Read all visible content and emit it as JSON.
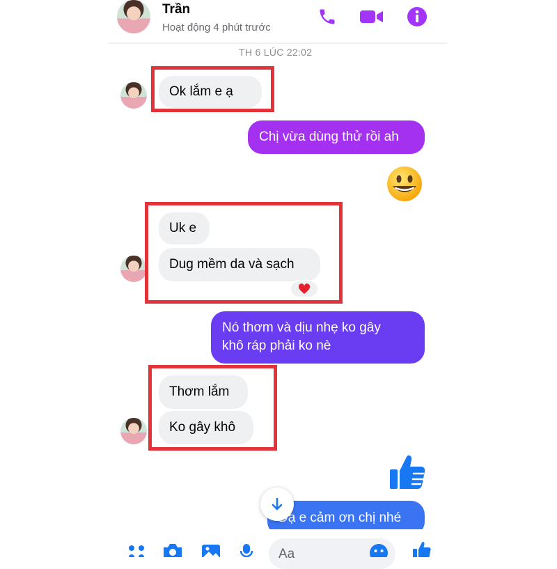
{
  "header": {
    "contact_name": "Trần",
    "status": "Hoạt động 4 phút trước",
    "actions": [
      "phone-icon",
      "video-icon",
      "info-icon"
    ]
  },
  "thread": {
    "timestamp": "TH 6 LÚC 22:02",
    "messages": [
      {
        "from": "contact",
        "text": "Ok lắm e ạ"
      },
      {
        "from": "me",
        "text": "Chị vừa dùng thử rồi ah"
      },
      {
        "from": "me",
        "emoji": "😀"
      },
      {
        "from": "contact",
        "text": "Uk e"
      },
      {
        "from": "contact",
        "text": "Dug mềm da và sạch",
        "reaction": "❤️"
      },
      {
        "from": "me",
        "text_line1": "Nó thơm và dịu nhẹ ko gây",
        "text_line2": "khô ráp phải ko nè"
      },
      {
        "from": "contact",
        "text": "Thơm lắm"
      },
      {
        "from": "contact",
        "text": "Ko gây khô"
      },
      {
        "from": "me",
        "emoji": "like-thumb"
      },
      {
        "from": "me",
        "text": "Dạ e cảm ơn chị nhé"
      }
    ]
  },
  "composer": {
    "placeholder": "Aa",
    "tools": [
      "menu-icon",
      "camera-icon",
      "gallery-icon",
      "mic-icon"
    ],
    "emoji_button": "smile-icon",
    "send_like": "like-icon"
  },
  "colors": {
    "accent_purple": "#a334fa",
    "bubble_purple": "#a431f0",
    "bubble_violet": "#6a3df2",
    "bubble_blue": "#3b74f2",
    "highlight_red": "#e2323a",
    "like_blue": "#1877f2"
  }
}
